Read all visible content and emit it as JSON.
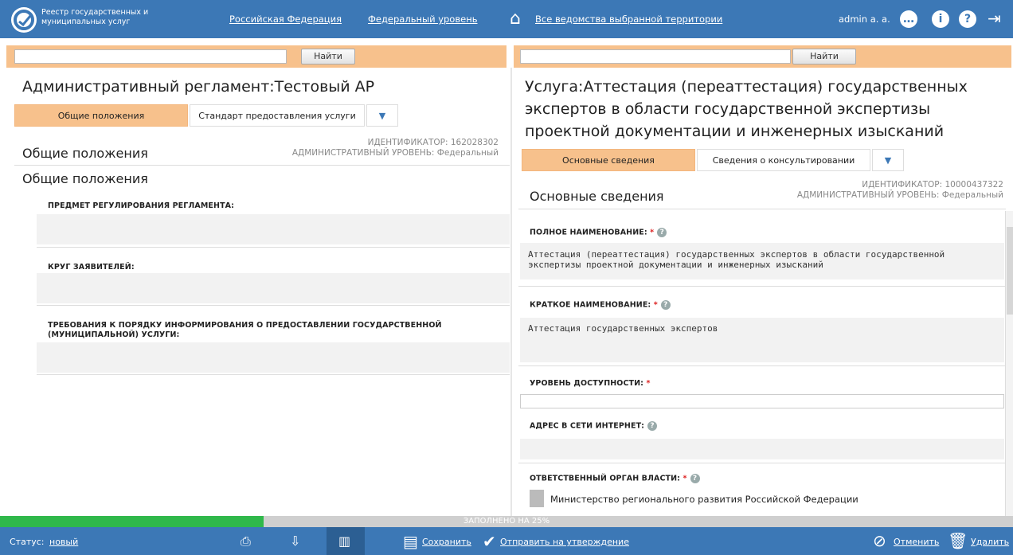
{
  "header": {
    "app_title": "Реестр государственных и муниципальных услуг",
    "link_federation": "Российская Федерация",
    "link_level": "Федеральный уровень",
    "link_all": "Все ведомства выбранной территории",
    "user": "admin a. a.",
    "icons": [
      "chat-icon",
      "info-icon",
      "help-icon",
      "logout-icon",
      "home-icon"
    ]
  },
  "search": {
    "button": "Найти",
    "left_value": "",
    "right_value": ""
  },
  "left": {
    "title": "Административный регламент:Тестовый АР",
    "tabs": [
      "Общие положения",
      "Стандарт предоставления услуги"
    ],
    "section": "Общие положения",
    "identifier": "ИДЕНТИФИКАТОР: 162028302",
    "admin_level": "АДМИНИСТРАТИВНЫЙ УРОВЕНЬ: Федеральный",
    "subsection": "Общие положения",
    "fields": [
      "ПРЕДМЕТ РЕГУЛИРОВАНИЯ РЕГЛАМЕНТА:",
      "КРУГ ЗАЯВИТЕЛЕЙ:",
      "ТРЕБОВАНИЯ К ПОРЯДКУ ИНФОРМИРОВАНИЯ О ПРЕДОСТАВЛЕНИИ ГОСУДАРСТВЕННОЙ (МУНИЦИПАЛЬНОЙ) УСЛУГИ:"
    ]
  },
  "right": {
    "title": "Услуга:Аттестация (переаттестация) государственных экспертов в области государственной экспертизы проектной документации и инженерных изысканий",
    "tabs": [
      "Основные сведения",
      "Сведения о консультировании"
    ],
    "section": "Основные сведения",
    "identifier": "ИДЕНТИФИКАТОР: 10000437322",
    "admin_level": "АДМИНИСТРАТИВНЫЙ УРОВЕНЬ: Федеральный",
    "fields": {
      "full_name_label": "ПОЛНОЕ НАИМЕНОВАНИЕ:",
      "full_name_value": "Аттестация (переаттестация) государственных экспертов в области государственной экспертизы проектной документации и инженерных изысканий",
      "short_name_label": "КРАТКОЕ НАИМЕНОВАНИЕ:",
      "short_name_value": "Аттестация государственных экспертов",
      "availability_label": "УРОВЕНЬ ДОСТУПНОСТИ:",
      "internet_label": "АДРЕС В СЕТИ ИНТЕРНЕТ:",
      "org_label": "ОТВЕТСТВЕННЫЙ ОРГАН ВЛАСТИ:",
      "org_value": "Министерство регионального развития Российской Федерации"
    }
  },
  "progress": {
    "text": "ЗАПОЛНЕНО НА 25%",
    "fraction": 0.25
  },
  "status": {
    "label": "Статус:",
    "value": "новый",
    "save": "Сохранить",
    "submit": "Отправить на утверждение",
    "cancel": "Отменить",
    "delete": "Удалить"
  },
  "colors": {
    "primary": "#3c78b6",
    "accent": "#f7c18c",
    "progress": "#2fb84a"
  }
}
